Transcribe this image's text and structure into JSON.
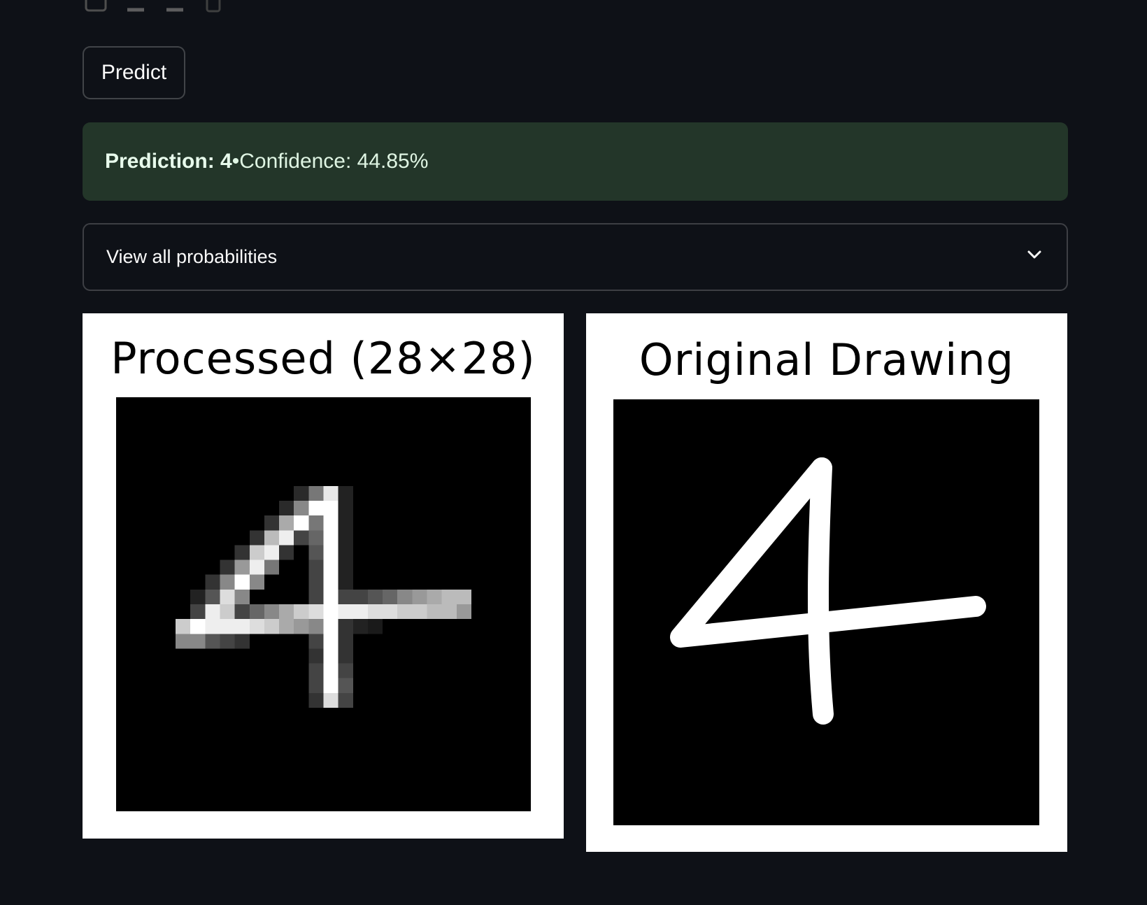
{
  "toolbar": {
    "icons": [
      "download-icon",
      "undo-icon",
      "redo-icon",
      "trash-icon"
    ]
  },
  "predict_button": {
    "label": "Predict"
  },
  "result": {
    "prediction_label": "Prediction: 4",
    "separator": " • ",
    "confidence_label": "Confidence: 44.85%",
    "background": "#233629"
  },
  "expander": {
    "label": "View all probabilities",
    "icon": "chevron-down-icon"
  },
  "figures": {
    "processed": {
      "title": "Processed (28×28)"
    },
    "original": {
      "title": "Original Drawing"
    }
  },
  "colors": {
    "app_background": "#0e1117",
    "text": "#fafafa"
  }
}
